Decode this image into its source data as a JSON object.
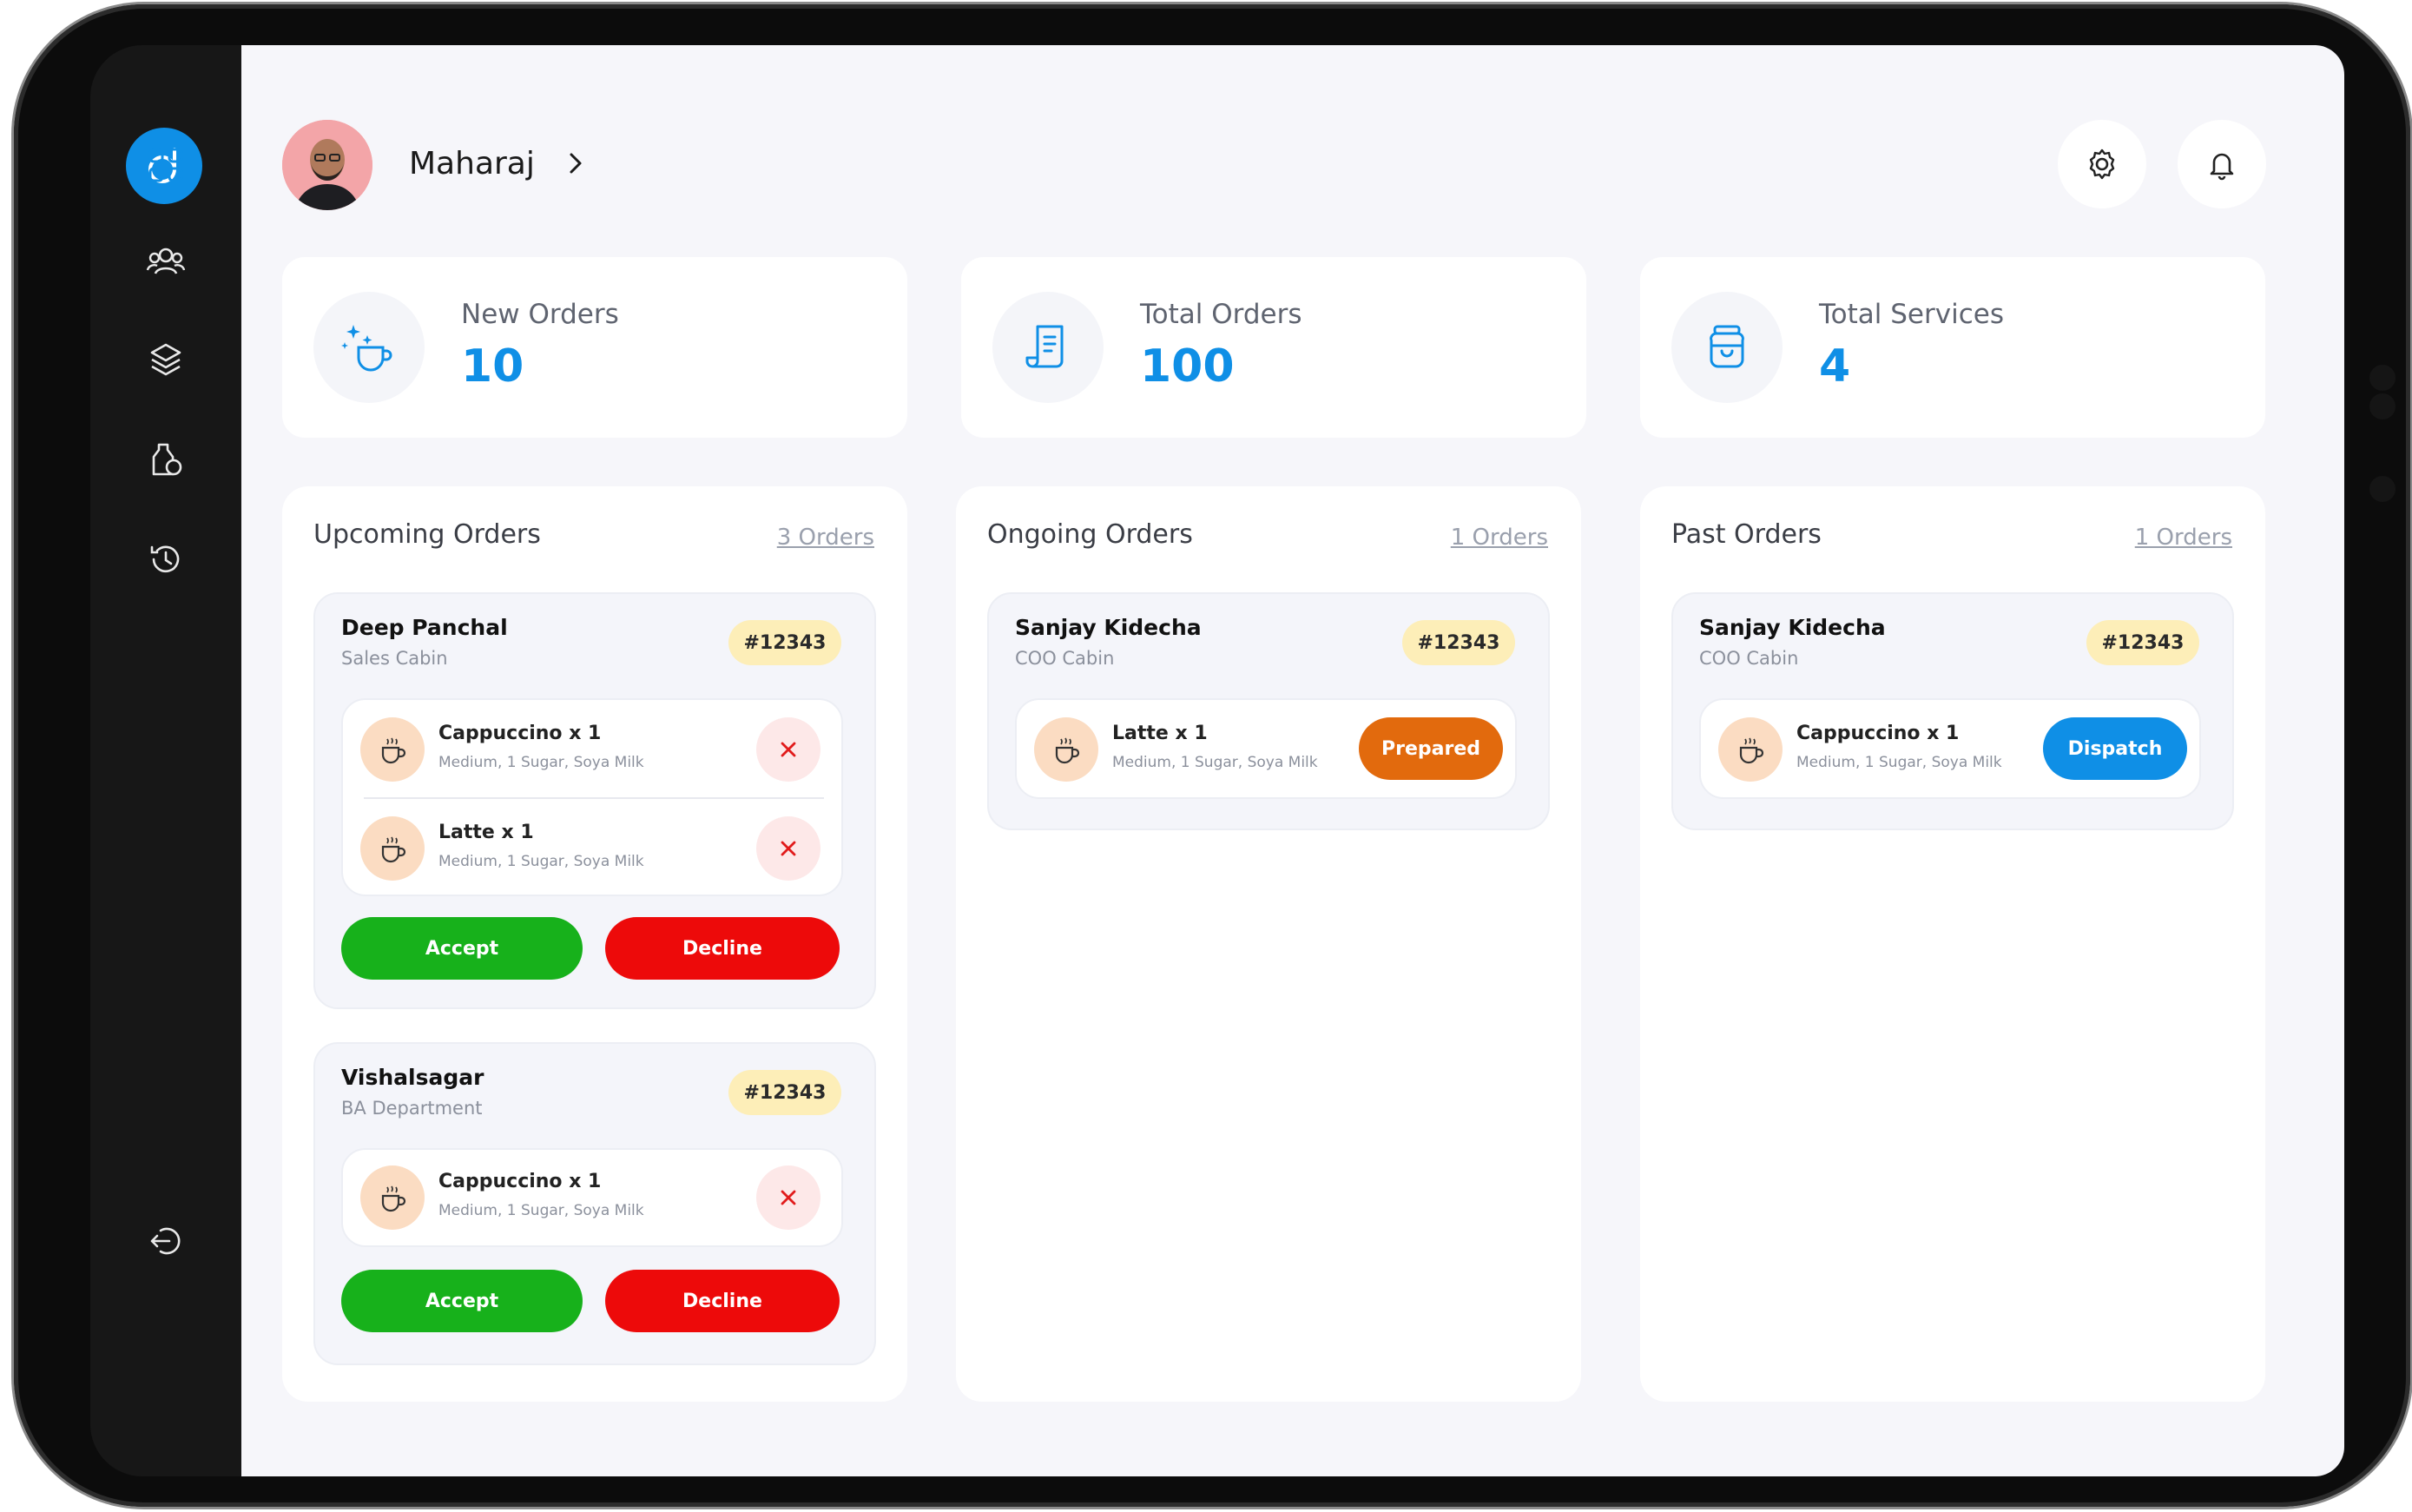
{
  "profile": {
    "name": "Maharaj"
  },
  "stats": [
    {
      "label": "New Orders",
      "value": "10",
      "icon": "coffee-sparkle-icon"
    },
    {
      "label": "Total Orders",
      "value": "100",
      "icon": "receipt-icon"
    },
    {
      "label": "Total Services",
      "value": "4",
      "icon": "jar-icon"
    }
  ],
  "upcoming": {
    "title": "Upcoming Orders",
    "count": "3 Orders",
    "orders": [
      {
        "customer": "Deep Panchal",
        "dept": "Sales Cabin",
        "id": "#12343",
        "items": [
          {
            "name": "Cappuccino x 1",
            "desc": "Medium,  1 Sugar, Soya Milk"
          },
          {
            "name": "Latte x 1",
            "desc": "Medium,  1 Sugar, Soya Milk"
          }
        ],
        "accept": "Accept",
        "decline": "Decline"
      },
      {
        "customer": "Vishalsagar",
        "dept": "BA Department",
        "id": "#12343",
        "items": [
          {
            "name": "Cappuccino x 1",
            "desc": "Medium,  1 Sugar, Soya Milk"
          }
        ],
        "accept": "Accept",
        "decline": "Decline"
      }
    ]
  },
  "ongoing": {
    "title": "Ongoing Orders",
    "count": "1 Orders",
    "orders": [
      {
        "customer": "Sanjay Kidecha",
        "dept": "COO Cabin",
        "id": "#12343",
        "items": [
          {
            "name": "Latte x 1",
            "desc": "Medium,  1 Sugar, Soya Milk"
          }
        ],
        "action": "Prepared"
      }
    ]
  },
  "past": {
    "title": "Past Orders",
    "count": "1 Orders",
    "orders": [
      {
        "customer": "Sanjay Kidecha",
        "dept": "COO Cabin",
        "id": "#12343",
        "items": [
          {
            "name": "Cappuccino x 1",
            "desc": "Medium,  1 Sugar, Soya Milk"
          }
        ],
        "action": "Dispatch"
      }
    ]
  },
  "colors": {
    "accent": "#0f8fe6",
    "accept": "#17b11b",
    "decline": "#ed0a0a",
    "prepared": "#e26a0d",
    "dispatch": "#0f8fe6",
    "badge": "#fdeeb8"
  },
  "nav_icons": [
    "dashboard-grid-icon",
    "users-icon",
    "layers-icon",
    "services-icon",
    "history-icon",
    "logout-icon"
  ]
}
